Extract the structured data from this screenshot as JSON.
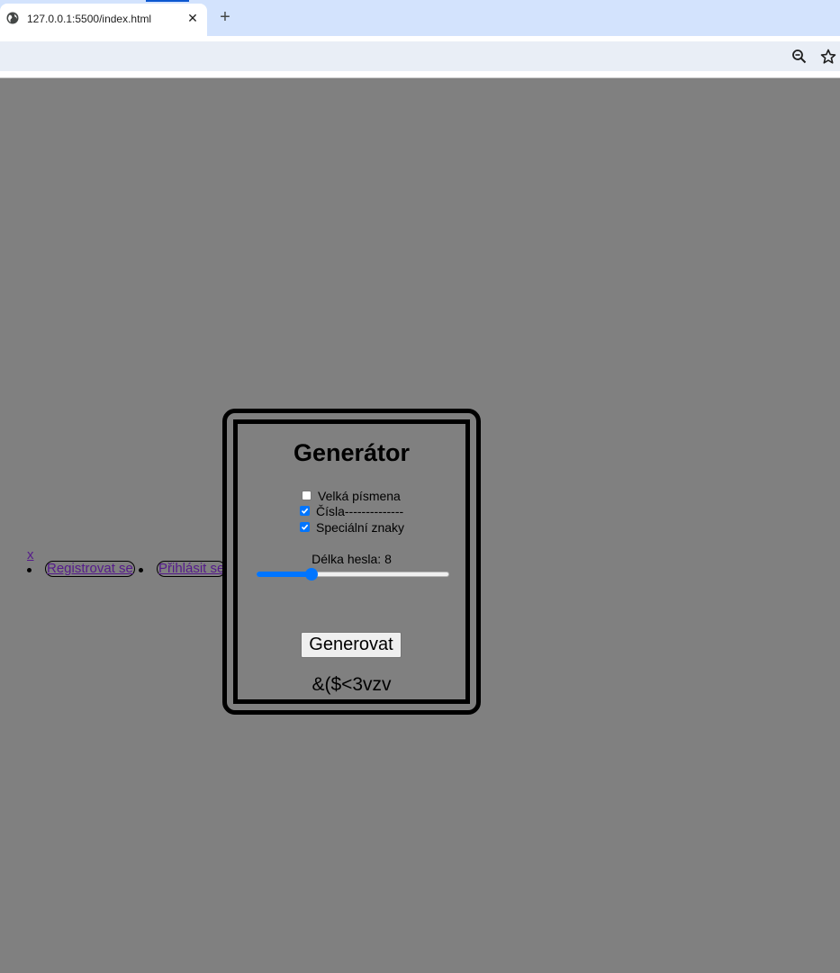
{
  "browser": {
    "tab_title": "127.0.0.1:5500/index.html",
    "close_tab_glyph": "✕",
    "new_tab_glyph": "+",
    "icons": [
      "globe-icon",
      "zoom-out-icon",
      "star-icon"
    ],
    "accent_color": "#0b57d0"
  },
  "page": {
    "background_color": "#808080",
    "close_link": "x",
    "nav": [
      {
        "label": "Registrovat se"
      },
      {
        "label": "Přihlásit se"
      }
    ],
    "generator": {
      "title": "Generátor",
      "options": [
        {
          "label": "Velká písmena",
          "checked": false
        },
        {
          "label": "Čísla--------------",
          "checked": true
        },
        {
          "label": "Speciální znaky",
          "checked": true
        }
      ],
      "length_label": "Délka hesla: 8",
      "length_value": 8,
      "slider_fraction": 0.27,
      "button_label": "Generovat",
      "password": "&($<3vzv"
    }
  }
}
